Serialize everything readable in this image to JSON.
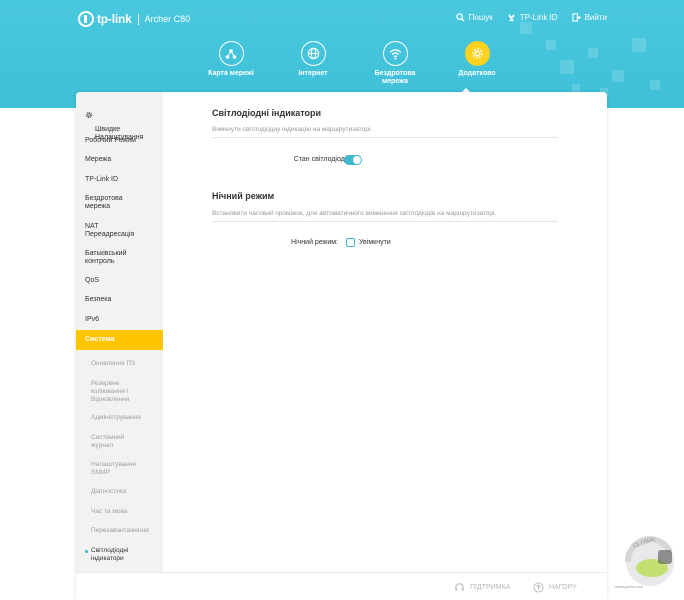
{
  "header": {
    "brand_name": "tp-link",
    "model": "Archer C80",
    "actions": [
      {
        "label": "Пошук",
        "icon": "search-icon"
      },
      {
        "label": "TP-Link ID",
        "icon": "user-id-icon"
      },
      {
        "label": "Вийти",
        "icon": "logout-icon"
      }
    ],
    "nav": [
      {
        "label": "Карта мережі",
        "icon": "network-map-icon",
        "active": false
      },
      {
        "label": "Інтернет",
        "icon": "globe-icon",
        "active": false
      },
      {
        "label": "Бездротова\nмережа",
        "icon": "wifi-icon",
        "active": false
      },
      {
        "label": "Додатково",
        "icon": "gear-icon",
        "active": true
      }
    ],
    "accent_color": "#49c8de",
    "active_color": "#ffd21f"
  },
  "sidebar": {
    "items": [
      {
        "label": "Швидке\nНалаштування"
      },
      {
        "label": "Робочий Режим"
      },
      {
        "label": "Мережа"
      },
      {
        "label": "TP-Link ID"
      },
      {
        "label": "Бездротова\nмережа"
      },
      {
        "label": "NAT\nПереадресація"
      },
      {
        "label": "Батьківський\nконтроль"
      },
      {
        "label": "QoS"
      },
      {
        "label": "Безпека"
      },
      {
        "label": "IPv6"
      }
    ],
    "active_item": "Система",
    "sub_items": [
      {
        "label": "Оновлення ПЗ"
      },
      {
        "label": "Резервне\nкопіювання і\nВідновлення"
      },
      {
        "label": "Адміністрування"
      },
      {
        "label": "Системний\nжурнал"
      },
      {
        "label": "Налаштування\nSNMP"
      },
      {
        "label": "Діагностика"
      },
      {
        "label": "Час та мова"
      },
      {
        "label": "Перезавантаження"
      },
      {
        "label": "Світлодіодні\nіндикатори"
      }
    ],
    "highlight_color": "#ffc400"
  },
  "main": {
    "led": {
      "title": "Світлодіодні індикатори",
      "description": "Вимкнути світлодіодну індикацію на маршрутизаторі.",
      "status_label": "Стан світлодіодів:",
      "status_on": true
    },
    "night": {
      "title": "Нічний режим",
      "description": "Встановити часовий проміжок, для автоматичного вимкнення світлодіодів на маршрутизаторі.",
      "mode_label": "Нічний режим:",
      "enable_label": "Увімкнути",
      "enabled": false
    }
  },
  "footer": {
    "support_label": "ПІДТРИМКА",
    "top_label": "НАГОРУ"
  },
  "watermark": {
    "text": "GLOBAL",
    "site": "www.gecid.com"
  }
}
